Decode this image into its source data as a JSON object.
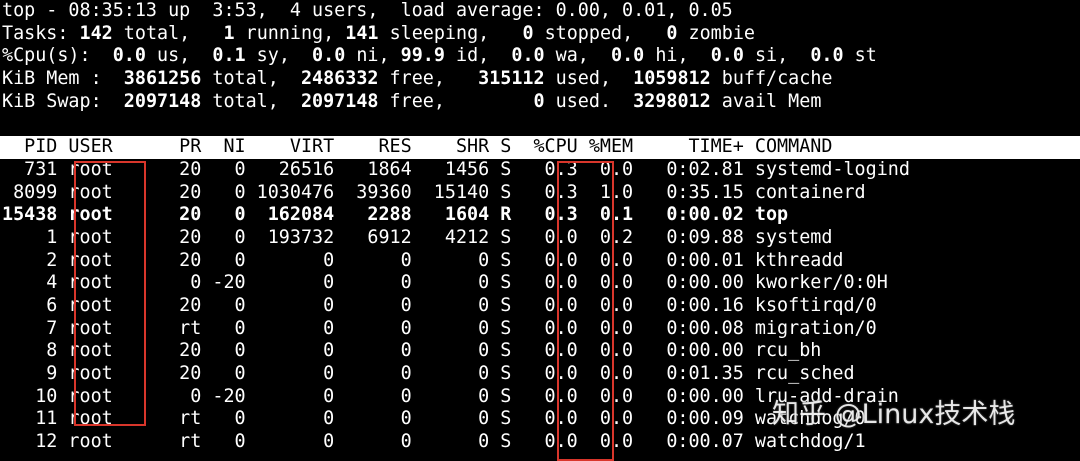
{
  "summary": {
    "uptime_line": [
      "top - 08:35:13 up  3:53,  4 users,  load average: 0.00, 0.01, 0.05"
    ],
    "tasks": [
      "Tasks: ",
      "142",
      " total,   ",
      "1",
      " running, ",
      "141",
      " sleeping,   ",
      "0",
      " stopped,   ",
      "0",
      " zombie"
    ],
    "cpu": [
      "%Cpu(s):  ",
      "0.0",
      " us,  ",
      "0.1",
      " sy,  ",
      "0.0",
      " ni, ",
      "99.9",
      " id,  ",
      "0.0",
      " wa,  ",
      "0.0",
      " hi,  ",
      "0.0",
      " si,  ",
      "0.0",
      " st"
    ],
    "mem": [
      "KiB Mem :  ",
      "3861256",
      " total,  ",
      "2486332",
      " free,   ",
      "315112",
      " used,  ",
      "1059812",
      " buff/cache"
    ],
    "swap": [
      "KiB Swap:  ",
      "2097148",
      " total,  ",
      "2097148",
      " free,        ",
      "0",
      " used.  ",
      "3298012",
      " avail Mem"
    ]
  },
  "table": {
    "header": "  PID USER      PR  NI    VIRT    RES    SHR S  %CPU %MEM     TIME+ COMMAND",
    "rows": [
      {
        "text": "  731 root      20   0   26516   1864   1456 S   0.3  0.0   0:02.81 systemd-logind",
        "bold": false
      },
      {
        "text": " 8099 root      20   0 1030476  39360  15140 S   0.3  1.0   0:35.15 containerd",
        "bold": false
      },
      {
        "text": "15438 root      20   0  162084   2288   1604 R   0.3  0.1   0:00.02 top",
        "bold": true
      },
      {
        "text": "    1 root      20   0  193732   6912   4212 S   0.0  0.2   0:09.88 systemd",
        "bold": false
      },
      {
        "text": "    2 root      20   0       0      0      0 S   0.0  0.0   0:00.01 kthreadd",
        "bold": false
      },
      {
        "text": "    4 root       0 -20       0      0      0 S   0.0  0.0   0:00.00 kworker/0:0H",
        "bold": false
      },
      {
        "text": "    6 root      20   0       0      0      0 S   0.0  0.0   0:00.16 ksoftirqd/0",
        "bold": false
      },
      {
        "text": "    7 root      rt   0       0      0      0 S   0.0  0.0   0:00.08 migration/0",
        "bold": false
      },
      {
        "text": "    8 root      20   0       0      0      0 S   0.0  0.0   0:00.00 rcu_bh",
        "bold": false
      },
      {
        "text": "    9 root      20   0       0      0      0 S   0.0  0.0   0:01.35 rcu_sched",
        "bold": false
      },
      {
        "text": "   10 root       0 -20       0      0      0 S   0.0  0.0   0:00.00 lru-add-drain",
        "bold": false
      },
      {
        "text": "   11 root      rt   0       0      0      0 S   0.0  0.0   0:00.09 watchdog/0",
        "bold": false
      },
      {
        "text": "   12 root      rt   0       0      0      0 S   0.0  0.0   0:00.07 watchdog/1",
        "bold": false
      }
    ]
  },
  "watermark": "知乎 @Linux技术栈",
  "colors": {
    "background": "#000000",
    "foreground": "#ffffff",
    "highlight_box": "#d9362b"
  }
}
